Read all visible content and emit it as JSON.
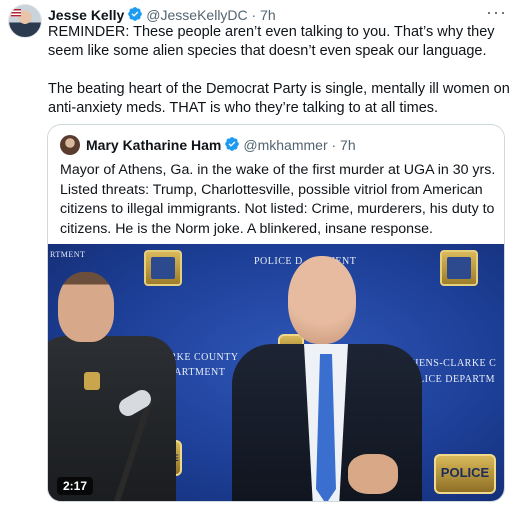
{
  "tweet": {
    "author_name": "Jesse Kelly",
    "handle": "@JesseKellyDC",
    "time": "· 7h",
    "more_label": "···",
    "paragraph1": "REMINDER: These people aren’t even talking to you. That’s why they seem like some alien species that doesn’t even speak our language.",
    "paragraph2": "The beating heart of the Democrat Party is single, mentally ill women on anti-anxiety meds. THAT is who they’re talking to at all times."
  },
  "quoted": {
    "author_name": "Mary Katharine Ham",
    "handle": "@mkhammer",
    "time": "· 7h",
    "text": "Mayor of Athens, Ga. in the wake of the first murder at UGA in 30 yrs. Listed threats: Trump, Charlottesville, possible vitriol from American citizens to illegal immigrants. Not listed: Crime, murderers, his duty to citizens. He is the Norm joke. A blinkered, insane response.",
    "video": {
      "duration": "2:17",
      "backdrop_text_1": "RTMENT",
      "backdrop_text_2": "POLICE D",
      "backdrop_text_3": "MENT",
      "backdrop_text_4": "HENS-CLARKE COUNTY",
      "backdrop_text_5": "ICE DEPARTMENT",
      "backdrop_text_6": "ATHENS-CLARKE C",
      "backdrop_text_7": "LICE DEPARTM",
      "badge_text": "POLICE"
    }
  },
  "colors": {
    "verified": "#1d9bf0",
    "muted_text": "#536471",
    "border": "#cfd9de"
  }
}
